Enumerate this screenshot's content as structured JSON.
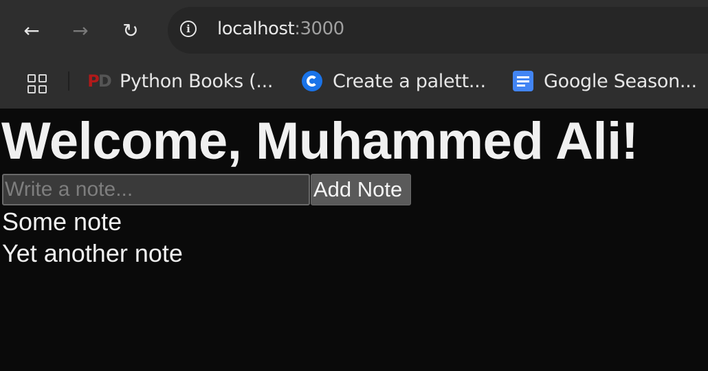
{
  "browser": {
    "url_host": "localhost",
    "url_port": ":3000",
    "nav": {
      "back_icon": "←",
      "forward_icon": "→",
      "reload_icon": "↻"
    },
    "bookmarks": [
      {
        "label": "Python Books (...",
        "icon": "pd-favicon"
      },
      {
        "label": "Create a palett...",
        "icon": "coolors-favicon"
      },
      {
        "label": "Google Season...",
        "icon": "google-docs-favicon"
      }
    ]
  },
  "page": {
    "title": "Welcome, Muhammed Ali!",
    "note_input": {
      "placeholder": "Write a note...",
      "value": ""
    },
    "add_button_label": "Add Note",
    "notes": [
      "Some note",
      "Yet another note"
    ]
  }
}
